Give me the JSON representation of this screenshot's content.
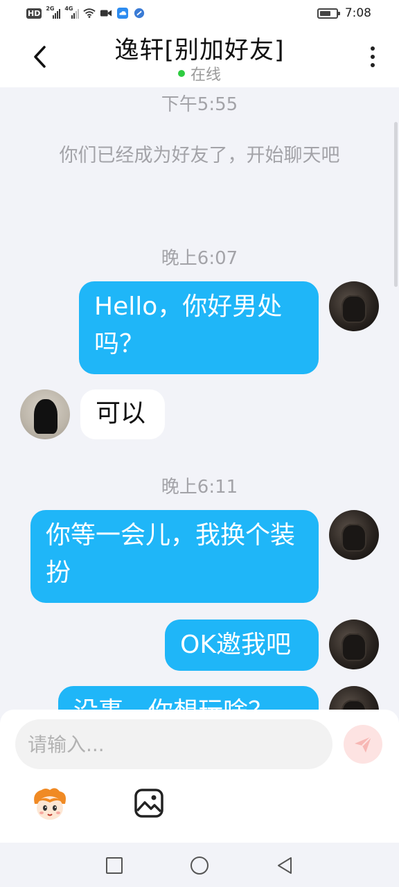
{
  "status_bar": {
    "hd": "HD",
    "sim1_tag": "2G",
    "sim2_tag": "4G",
    "time": "7:08",
    "battery_level": 0.75
  },
  "header": {
    "back_icon": "chevron-left-icon",
    "title": "逸轩[别加好友]",
    "status": "在线",
    "status_color": "#2ecc40",
    "more_icon": "more-vertical-icon"
  },
  "messages": {
    "ts1": "下午5:55",
    "system": "你们已经成为好友了，开始聊天吧",
    "ts2": "晚上6:07",
    "m1": "Hello，你好男处吗？",
    "m2": "可以",
    "ts3": "晚上6:11",
    "m3": "你等一会儿，我换个装扮",
    "m4": "OK邀我吧",
    "m5": "没事，你想玩啥？"
  },
  "composer": {
    "placeholder": "请输入...",
    "send_icon": "send-icon",
    "emoji_icon": "cartoon-emoji-icon",
    "image_icon": "image-icon"
  },
  "nav": {
    "recents_icon": "square-icon",
    "home_icon": "circle-icon",
    "back_icon": "triangle-back-icon"
  },
  "colors": {
    "outgoing_bubble": "#1fb6f8",
    "incoming_bubble": "#ffffff",
    "chat_background": "#f2f3f8"
  }
}
